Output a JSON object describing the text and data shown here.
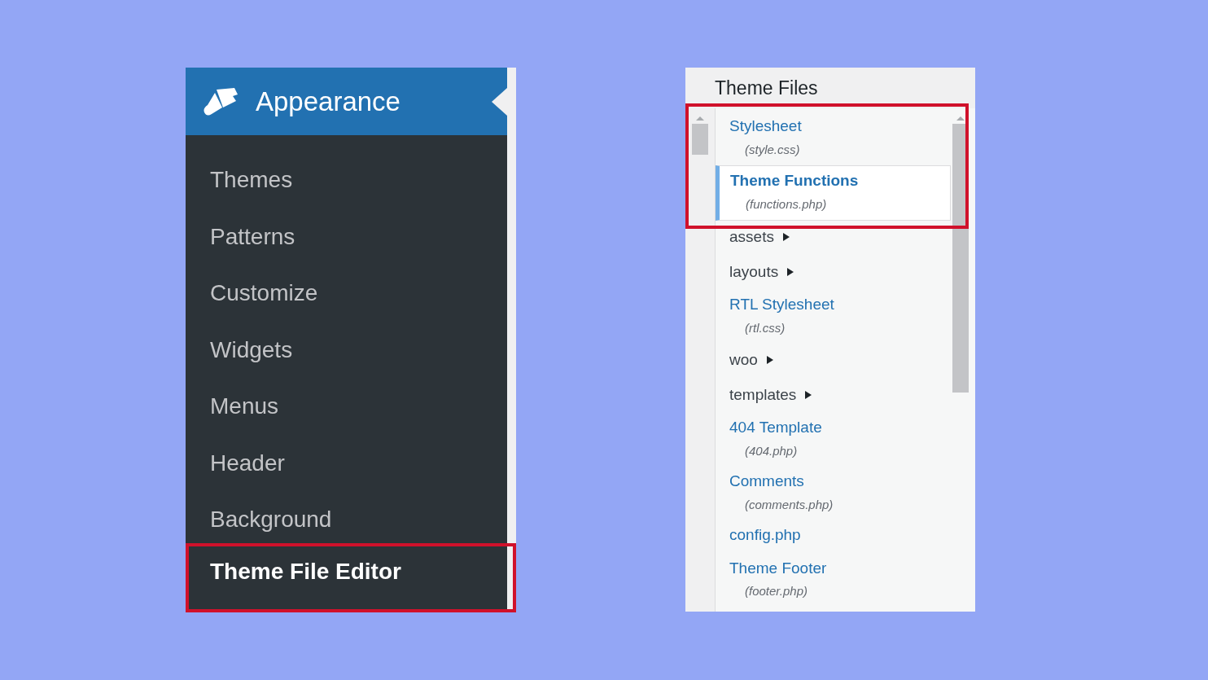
{
  "admin_menu": {
    "header": {
      "label": "Appearance"
    },
    "items": [
      {
        "label": "Themes",
        "selected": false,
        "highlighted": false
      },
      {
        "label": "Patterns",
        "selected": false,
        "highlighted": false
      },
      {
        "label": "Customize",
        "selected": false,
        "highlighted": false
      },
      {
        "label": "Widgets",
        "selected": false,
        "highlighted": false
      },
      {
        "label": "Menus",
        "selected": false,
        "highlighted": false
      },
      {
        "label": "Header",
        "selected": false,
        "highlighted": false
      },
      {
        "label": "Background",
        "selected": false,
        "highlighted": false
      },
      {
        "label": "Theme File Editor",
        "selected": true,
        "highlighted": true
      }
    ]
  },
  "theme_files": {
    "title": "Theme Files",
    "highlighted_items": [
      {
        "kind": "file",
        "label": "Stylesheet",
        "filename": "(style.css)",
        "selected": false
      },
      {
        "kind": "file",
        "label": "Theme Functions",
        "filename": "(functions.php)",
        "selected": true
      }
    ],
    "items": [
      {
        "kind": "folder",
        "label": "assets",
        "expanded": false,
        "selected": false
      },
      {
        "kind": "folder",
        "label": "layouts",
        "expanded": false,
        "selected": false
      },
      {
        "kind": "file",
        "label": "RTL Stylesheet",
        "filename": "(rtl.css)",
        "selected": false
      },
      {
        "kind": "folder",
        "label": "woo",
        "expanded": false,
        "selected": false
      },
      {
        "kind": "folder",
        "label": "templates",
        "expanded": false,
        "selected": false
      },
      {
        "kind": "file",
        "label": "404 Template",
        "filename": "(404.php)",
        "selected": false
      },
      {
        "kind": "file",
        "label": "Comments",
        "filename": "(comments.php)",
        "selected": false
      },
      {
        "kind": "file",
        "label": "config.php",
        "selected": false
      },
      {
        "kind": "file",
        "label": "Theme Footer",
        "filename": "(footer.php)",
        "selected": false
      }
    ]
  }
}
